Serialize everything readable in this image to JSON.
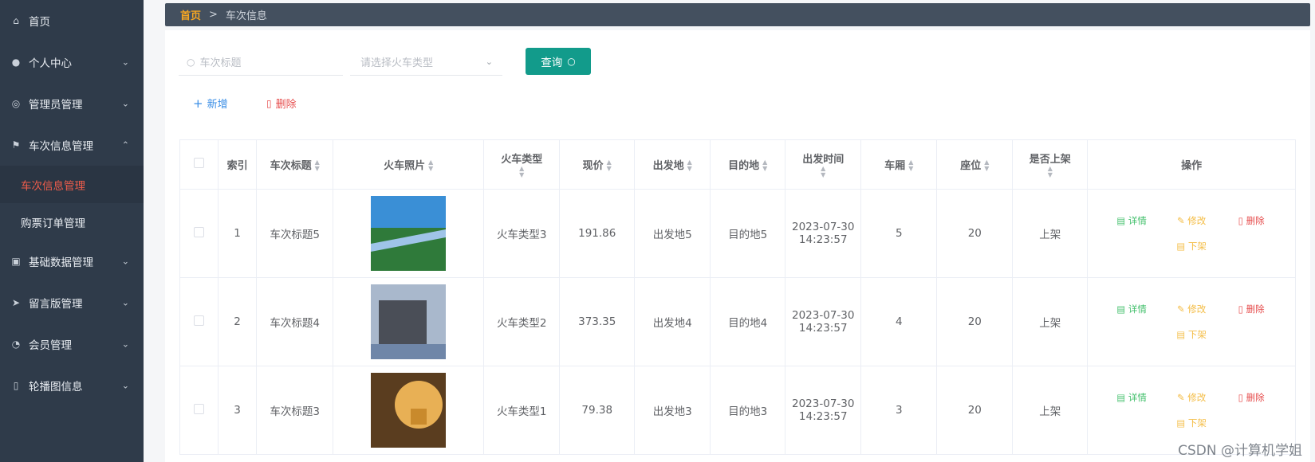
{
  "sidebar": {
    "items": [
      {
        "label": "首页",
        "icon": "home-icon"
      },
      {
        "label": "个人中心",
        "icon": "user-icon"
      },
      {
        "label": "管理员管理",
        "icon": "compass-icon"
      },
      {
        "label": "车次信息管理",
        "icon": "flag-icon"
      },
      {
        "label": "基础数据管理",
        "icon": "clipboard-icon"
      },
      {
        "label": "留言版管理",
        "icon": "send-icon"
      },
      {
        "label": "会员管理",
        "icon": "dashboard-icon"
      },
      {
        "label": "轮播图信息",
        "icon": "mobile-icon"
      }
    ],
    "subitems": [
      {
        "label": "车次信息管理",
        "active": true
      },
      {
        "label": "购票订单管理",
        "active": false
      }
    ]
  },
  "breadcrumb": {
    "home": "首页",
    "sep": ">",
    "current": "车次信息"
  },
  "search": {
    "title_placeholder": "车次标题",
    "type_placeholder": "请选择火车类型",
    "query_label": "查询"
  },
  "actions": {
    "add": "新增",
    "delete": "删除"
  },
  "table": {
    "headers": {
      "index": "索引",
      "title": "车次标题",
      "photo": "火车照片",
      "type": "火车类型",
      "price": "现价",
      "from": "出发地",
      "to": "目的地",
      "time": "出发时间",
      "car": "车厢",
      "seat": "座位",
      "onsale": "是否上架",
      "ops": "操作"
    },
    "rows": [
      {
        "index": "1",
        "title": "车次标题5",
        "type": "火车类型3",
        "price": "191.86",
        "from": "出发地5",
        "to": "目的地5",
        "date": "2023-07-30",
        "clock": "14:23:57",
        "car": "5",
        "seat": "20",
        "onsale": "上架",
        "photo_colors": [
          "#3a8fd6",
          "#2f7a3a",
          "#9fc4e8"
        ]
      },
      {
        "index": "2",
        "title": "车次标题4",
        "type": "火车类型2",
        "price": "373.35",
        "from": "出发地4",
        "to": "目的地4",
        "date": "2023-07-30",
        "clock": "14:23:57",
        "car": "4",
        "seat": "20",
        "onsale": "上架",
        "photo_colors": [
          "#6f86a8",
          "#4a4e57",
          "#a9b8cc"
        ]
      },
      {
        "index": "3",
        "title": "车次标题3",
        "type": "火车类型1",
        "price": "79.38",
        "from": "出发地3",
        "to": "目的地3",
        "date": "2023-07-30",
        "clock": "14:23:57",
        "car": "3",
        "seat": "20",
        "onsale": "上架",
        "photo_colors": [
          "#c98a2c",
          "#5a3d1f",
          "#e8b055"
        ]
      }
    ],
    "ops": {
      "detail": "详情",
      "edit": "修改",
      "remove": "删除",
      "down": "下架"
    }
  },
  "watermark": "CSDN @计算机学姐"
}
